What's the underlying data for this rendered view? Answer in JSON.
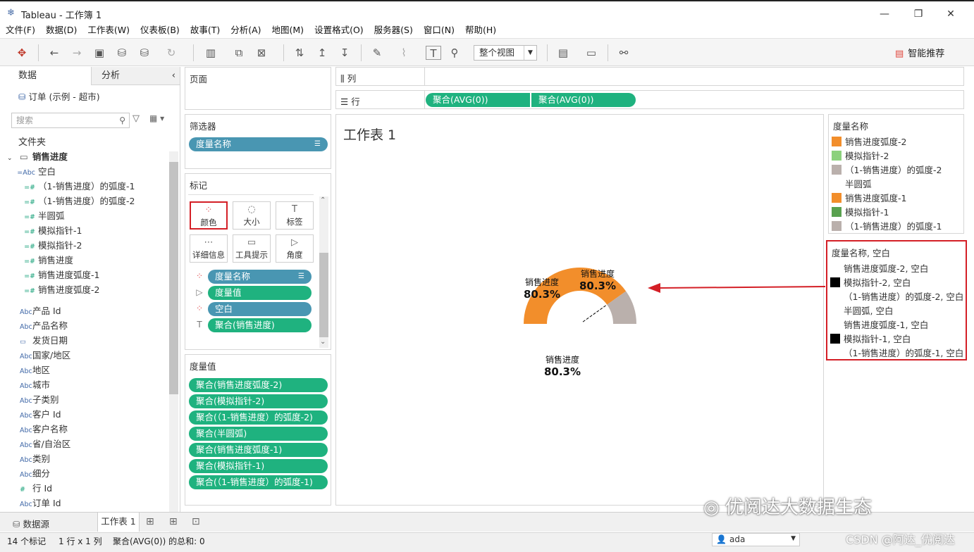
{
  "window": {
    "app": "Tableau",
    "title": "Tableau - 工作簿 1",
    "minimize": "—",
    "maximize": "❐",
    "close": "✕"
  },
  "menu": [
    "文件(F)",
    "数据(D)",
    "工作表(W)",
    "仪表板(B)",
    "故事(T)",
    "分析(A)",
    "地图(M)",
    "设置格式(O)",
    "服务器(S)",
    "窗口(N)",
    "帮助(H)"
  ],
  "toolbar": {
    "fit_value": "整个视图",
    "smart_label": "智能推荐"
  },
  "data_pane": {
    "tab_data": "数据",
    "tab_analysis": "分析",
    "datasource": "订单 (示例 - 超市)",
    "search_placeholder": "搜索",
    "folders_label": "文件夹",
    "folder_name": "销售进度",
    "folder_fields": [
      {
        "icon": "=Abc",
        "label": "空白"
      },
      {
        "icon": "=#",
        "label": "（1-销售进度）的弧度-1"
      },
      {
        "icon": "=#",
        "label": "（1-销售进度）的弧度-2"
      },
      {
        "icon": "=#",
        "label": "半圆弧"
      },
      {
        "icon": "=#",
        "label": "模拟指针-1"
      },
      {
        "icon": "=#",
        "label": "模拟指针-2"
      },
      {
        "icon": "=#",
        "label": "销售进度"
      },
      {
        "icon": "=#",
        "label": "销售进度弧度-1"
      },
      {
        "icon": "=#",
        "label": "销售进度弧度-2"
      }
    ],
    "fields": [
      {
        "icon": "Abc",
        "label": "产品 Id"
      },
      {
        "icon": "Abc",
        "label": "产品名称"
      },
      {
        "icon": "▭",
        "label": "发货日期"
      },
      {
        "icon": "Abc",
        "label": "国家/地区"
      },
      {
        "icon": "Abc",
        "label": "地区"
      },
      {
        "icon": "Abc",
        "label": "城市"
      },
      {
        "icon": "Abc",
        "label": "子类别"
      },
      {
        "icon": "Abc",
        "label": "客户 Id"
      },
      {
        "icon": "Abc",
        "label": "客户名称"
      },
      {
        "icon": "Abc",
        "label": "省/自治区"
      },
      {
        "icon": "Abc",
        "label": "类别"
      },
      {
        "icon": "Abc",
        "label": "细分"
      },
      {
        "icon": "#",
        "label": "行 Id"
      },
      {
        "icon": "Abc",
        "label": "订单 Id"
      }
    ]
  },
  "cards": {
    "pages_title": "页面",
    "filters_title": "筛选器",
    "filter_pill": "度量名称",
    "marks_title": "标记",
    "mark_buttons": [
      {
        "label": "颜色",
        "icon": "⁘"
      },
      {
        "label": "大小",
        "icon": "◌"
      },
      {
        "label": "标签",
        "icon": "T"
      },
      {
        "label": "详细信息",
        "icon": "⋯"
      },
      {
        "label": "工具提示",
        "icon": "▭"
      },
      {
        "label": "角度",
        "icon": "▷"
      }
    ],
    "mark_pills": [
      {
        "label": "度量名称",
        "icon": "⁘"
      },
      {
        "label": "度量值",
        "icon": "▷"
      },
      {
        "label": "空白",
        "icon": "⁘"
      },
      {
        "label": "聚合(销售进度)",
        "icon": "T"
      }
    ],
    "measure_values_title": "度量值",
    "measure_values": [
      "聚合(销售进度弧度-2)",
      "聚合(模拟指针-2)",
      "聚合(（1-销售进度）的弧度-2)",
      "聚合(半圆弧)",
      "聚合(销售进度弧度-1)",
      "聚合(模拟指针-1)",
      "聚合(（1-销售进度）的弧度-1)"
    ]
  },
  "shelves": {
    "columns_label": "列",
    "rows_label": "行",
    "row_pills": [
      "聚合(AVG(0))",
      "聚合(AVG(0))"
    ]
  },
  "view": {
    "sheet_title": "工作表 1",
    "labels": [
      {
        "name": "销售进度",
        "value": "80.3%"
      },
      {
        "name": "销售进度",
        "value": "80.3%"
      },
      {
        "name": "销售进度",
        "value": "80.3%"
      }
    ],
    "gauge": {
      "progress": 0.803,
      "progress_color": "#f28e2b",
      "remainder_color": "#bab0ac",
      "needle_color": "#000000"
    }
  },
  "legend1": {
    "title": "度量名称",
    "items": [
      {
        "label": "销售进度弧度-2",
        "color": "#f28e2b"
      },
      {
        "label": "模拟指针-2",
        "color": "#8cd17d"
      },
      {
        "label": "（1-销售进度）的弧度-2",
        "color": "#bab0ac"
      },
      {
        "label": "半圆弧",
        "color": "#ffffff"
      },
      {
        "label": "销售进度弧度-1",
        "color": "#f28e2b"
      },
      {
        "label": "模拟指针-1",
        "color": "#59a14f"
      },
      {
        "label": "（1-销售进度）的弧度-1",
        "color": "#bab0ac"
      }
    ]
  },
  "legend2": {
    "title": "度量名称, 空白",
    "items": [
      {
        "label": "销售进度弧度-2, 空白",
        "color": "#ffffff"
      },
      {
        "label": "模拟指针-2, 空白",
        "color": "#000000"
      },
      {
        "label": "（1-销售进度）的弧度-2, 空白",
        "color": "#ffffff"
      },
      {
        "label": "半圆弧, 空白",
        "color": "#ffffff"
      },
      {
        "label": "销售进度弧度-1, 空白",
        "color": "#ffffff"
      },
      {
        "label": "模拟指针-1, 空白",
        "color": "#000000"
      },
      {
        "label": "（1-销售进度）的弧度-1, 空白",
        "color": "#ffffff"
      }
    ]
  },
  "tabs": {
    "datasource": "数据源",
    "sheet1": "工作表 1"
  },
  "status": {
    "marks": "14 个标记",
    "grid": "1 行 x 1 列",
    "sum": "聚合(AVG(0)) 的总和: 0",
    "user": "ada"
  },
  "watermark": "优阅达大数据生态",
  "credit": "CSDN @阿达_优阅达"
}
